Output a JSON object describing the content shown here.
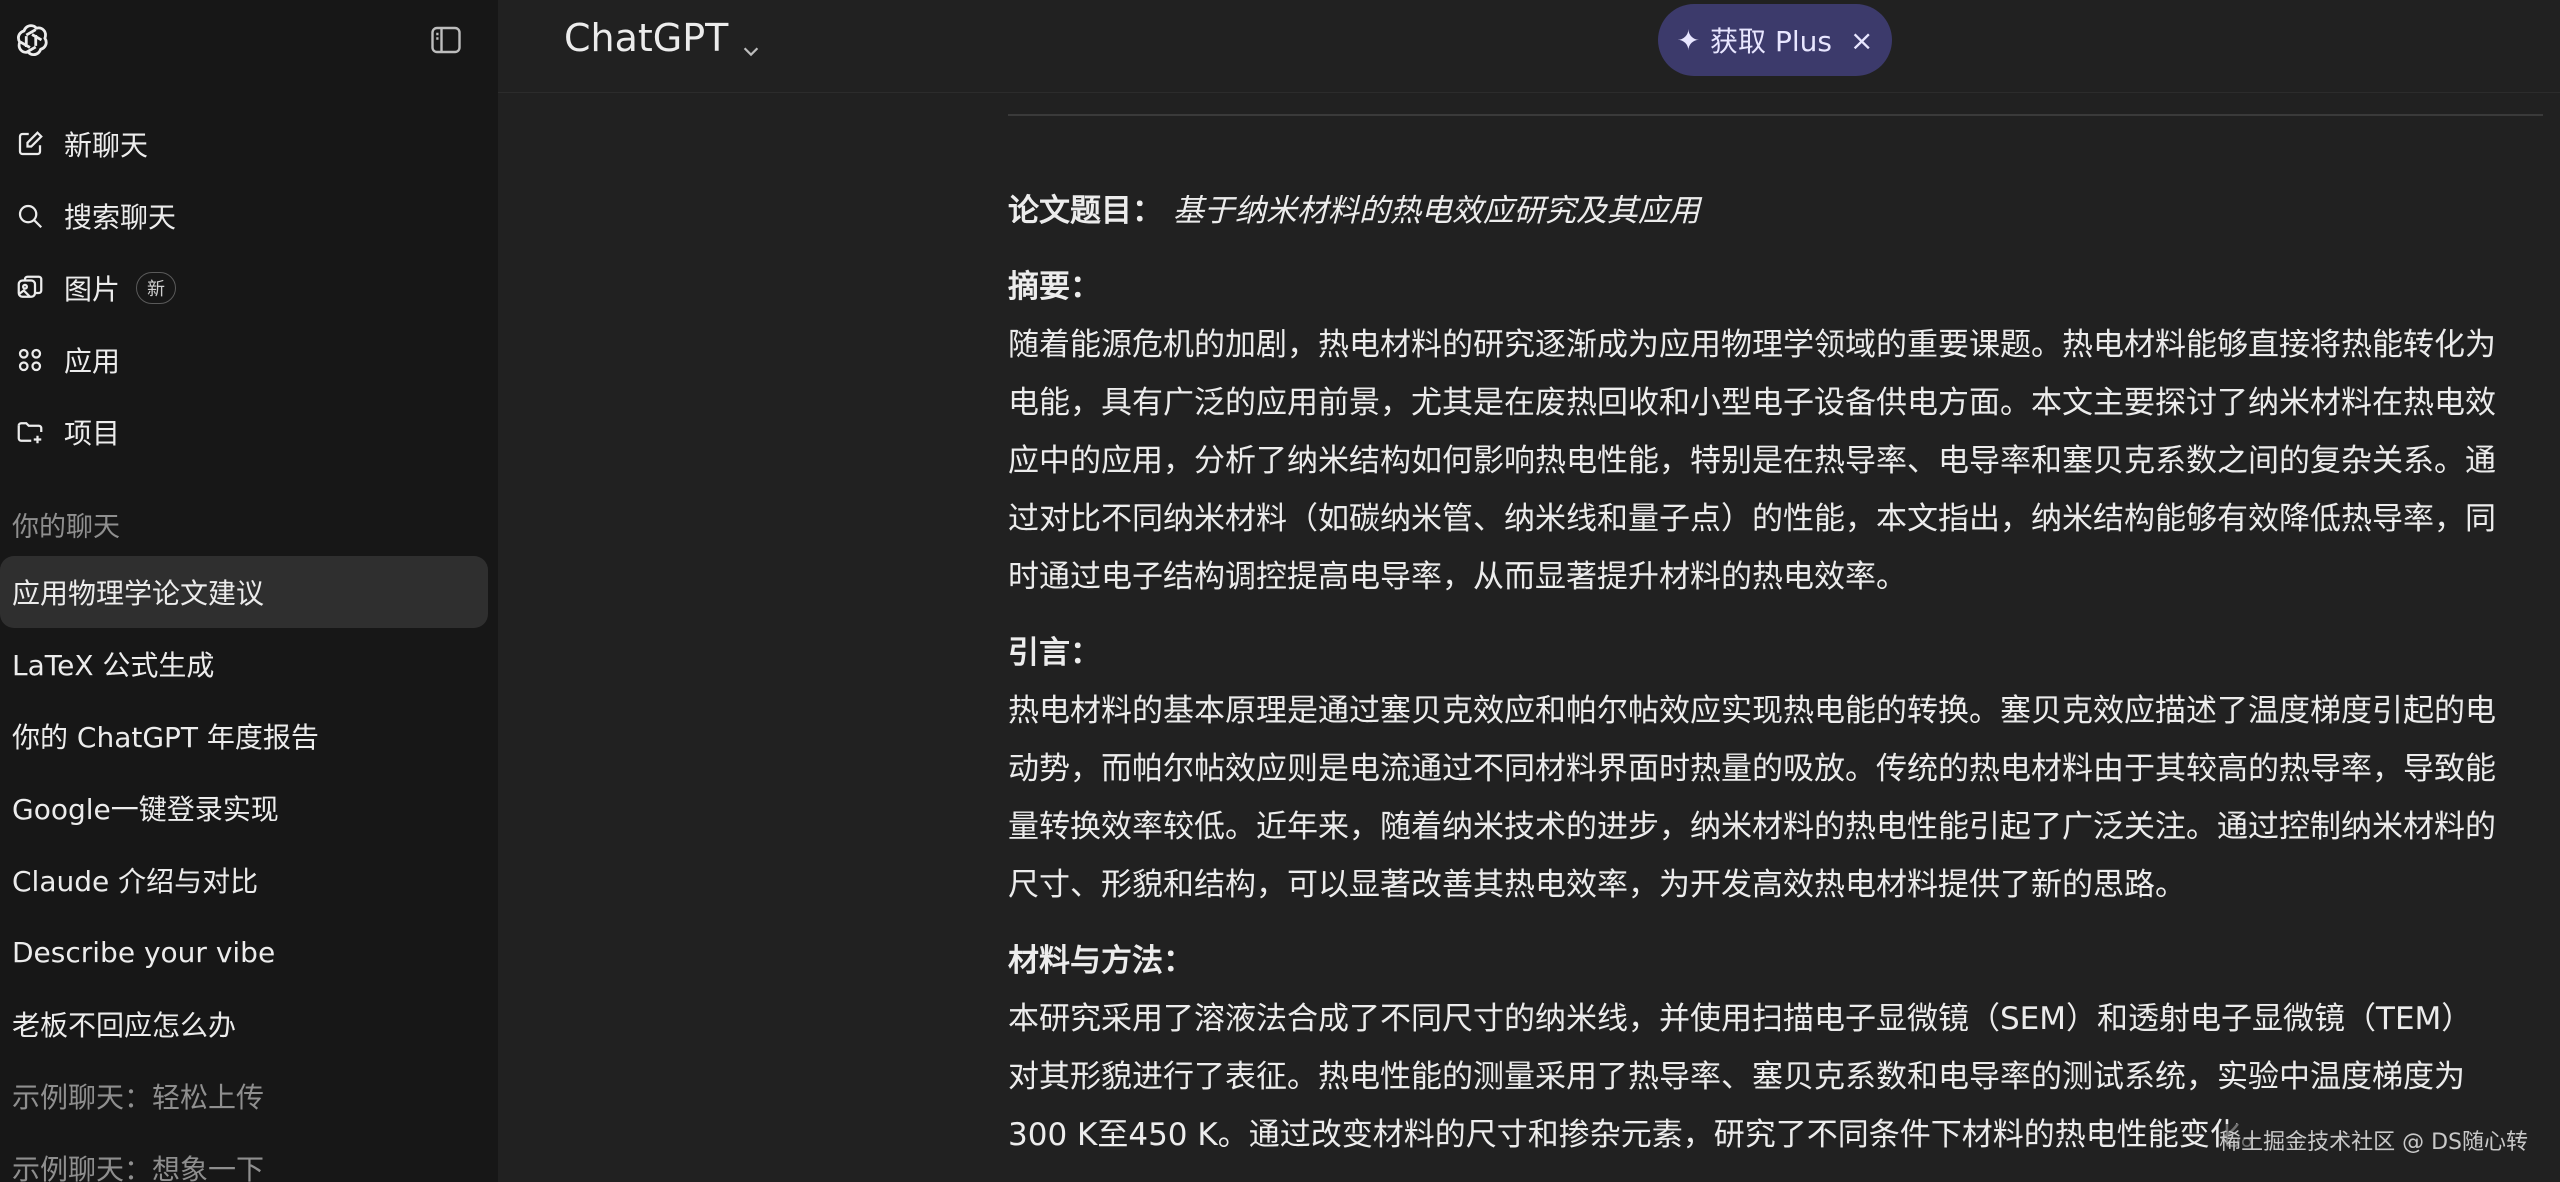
{
  "sidebar": {
    "nav": [
      {
        "label": "新聊天",
        "icon": "new-chat-icon"
      },
      {
        "label": "搜索聊天",
        "icon": "search-icon"
      },
      {
        "label": "图片",
        "icon": "images-icon",
        "badge": "新"
      },
      {
        "label": "应用",
        "icon": "apps-icon"
      },
      {
        "label": "项目",
        "icon": "folder-icon"
      }
    ],
    "section_label": "你的聊天",
    "chats": [
      {
        "label": "应用物理学论文建议",
        "active": true
      },
      {
        "label": "LaTeX 公式生成"
      },
      {
        "label": "你的 ChatGPT 年度报告"
      },
      {
        "label": "Google一键登录实现"
      },
      {
        "label": "Claude 介绍与对比"
      },
      {
        "label": "Describe your vibe"
      },
      {
        "label": "老板不回应怎么办"
      },
      {
        "label": "示例聊天：轻松上传",
        "muted": true
      },
      {
        "label": "示例聊天：想象一下",
        "muted": true
      }
    ]
  },
  "header": {
    "model": "ChatGPT",
    "upgrade_label": "获取 Plus",
    "close_symbol": "×"
  },
  "doc": {
    "title_label": "论文题目：",
    "title_value": "基于纳米材料的热电效应研究及其应用",
    "sections": [
      {
        "heading": "摘要：",
        "lines": [
          "随着能源危机的加剧，热电材料的研究逐渐成为应用物理学领域的重要课题。热电材料能够直接将热能转化为",
          "电能，具有广泛的应用前景，尤其是在废热回收和小型电子设备供电方面。本文主要探讨了纳米材料在热电效",
          "应中的应用，分析了纳米结构如何影响热电性能，特别是在热导率、电导率和塞贝克系数之间的复杂关系。通",
          "过对比不同纳米材料（如碳纳米管、纳米线和量子点）的性能，本文指出，纳米结构能够有效降低热导率，同",
          "时通过电子结构调控提高电导率，从而显著提升材料的热电效率。"
        ]
      },
      {
        "heading": "引言：",
        "lines": [
          "热电材料的基本原理是通过塞贝克效应和帕尔帖效应实现热电能的转换。塞贝克效应描述了温度梯度引起的电",
          "动势，而帕尔帖效应则是电流通过不同材料界面时热量的吸放。传统的热电材料由于其较高的热导率，导致能",
          "量转换效率较低。近年来，随着纳米技术的进步，纳米材料的热电性能引起了广泛关注。通过控制纳米材料的",
          "尺寸、形貌和结构，可以显著改善其热电效率，为开发高效热电材料提供了新的思路。"
        ]
      },
      {
        "heading": "材料与方法：",
        "lines": [
          "本研究采用了溶液法合成了不同尺寸的纳米线，并使用扫描电子显微镜（SEM）和透射电子显微镜（TEM）",
          "对其形貌进行了表征。热电性能的测量采用了热导率、塞贝克系数和电导率的测试系统，实验中温度梯度为",
          "300 K至450 K。通过改变材料的尺寸和掺杂元素，研究了不同条件下材料的热电性能变化。"
        ]
      }
    ]
  },
  "watermark": "稀土掘金技术社区 @ DS随心转"
}
